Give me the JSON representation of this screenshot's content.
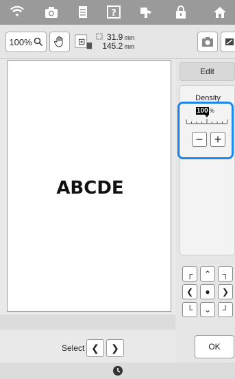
{
  "topbar": {
    "icons": [
      "wifi-icon",
      "camera-icon",
      "document-icon",
      "help-icon",
      "sewing-icon",
      "lock-icon",
      "home-icon"
    ]
  },
  "toolbar": {
    "zoom_label": "100%",
    "size": {
      "width_value": "31.9",
      "height_value": "145.2",
      "unit": "mm"
    }
  },
  "canvas": {
    "text": "ABCDE"
  },
  "right_panel": {
    "edit_label": "Edit",
    "density": {
      "title": "Density",
      "value": "100",
      "value_unit": "%",
      "minus_label": "−",
      "plus_label": "+"
    },
    "ok_label": "OK"
  },
  "select": {
    "label": "Select"
  },
  "colors": {
    "highlight": "#1e86e8",
    "topbar": "#9a9a9a"
  }
}
